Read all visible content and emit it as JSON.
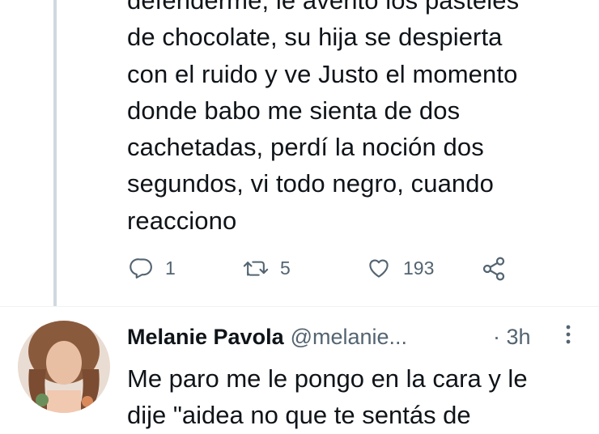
{
  "tweet": {
    "lines": [
      "defenderme, le avento los pasteles",
      "de chocolate, su hija se despierta",
      "con el ruido y ve Justo el momento",
      "donde babo me sienta de dos",
      "cachetadas, perdí la noción dos",
      "segundos, vi todo negro, cuando",
      "reacciono"
    ],
    "reply_count": "1",
    "retweet_count": "5",
    "like_count": "193"
  },
  "reply": {
    "name": "Melanie Pavola",
    "handle": "@melanie...",
    "time": "· 3h",
    "lines": [
      "Me paro me le pongo en la cara y le",
      "dije \"aidea no que te sentás de"
    ]
  },
  "icons": {
    "reply": "reply-icon",
    "retweet": "retweet-icon",
    "like": "heart-icon",
    "share": "share-icon",
    "more": "more-options-icon"
  },
  "colors": {
    "text": "#0f1419",
    "secondary": "#536471",
    "thread_line": "#cfd9de"
  }
}
